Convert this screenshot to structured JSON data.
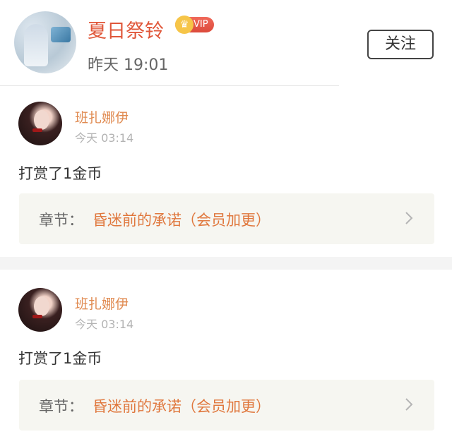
{
  "header": {
    "name": "夏日祭铃",
    "vip_label": "VIP",
    "vip_crown_glyph": "♛",
    "time": "昨天 19:01",
    "follow_label": "关注"
  },
  "records": [
    {
      "user": "班扎娜伊",
      "time": "今天 03:14",
      "text": "打赏了1金币",
      "chapter_prefix": "章节：",
      "chapter_title": "昏迷前的承诺（会员加更）"
    },
    {
      "user": "班扎娜伊",
      "time": "今天 03:14",
      "text": "打赏了1金币",
      "chapter_prefix": "章节：",
      "chapter_title": "昏迷前的承诺（会员加更）"
    }
  ],
  "colors": {
    "accent_name": "#e0573a",
    "user_name": "#e08a50",
    "chapter_title": "#e0783e"
  },
  "icons": [
    "avatar",
    "vip-crown-icon",
    "chevron-right-icon"
  ]
}
